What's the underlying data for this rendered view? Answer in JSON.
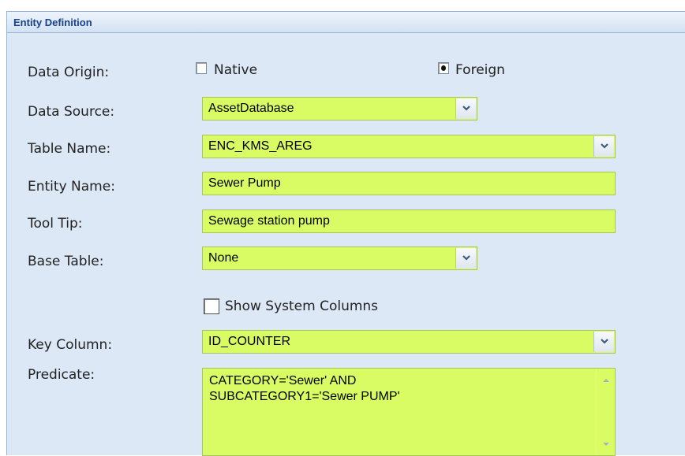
{
  "panel": {
    "title": "Entity Definition"
  },
  "data_origin": {
    "label": "Data Origin:",
    "options": [
      "Native",
      "Foreign"
    ],
    "selected": "Foreign"
  },
  "data_source": {
    "label": "Data Source:",
    "value": "AssetDatabase"
  },
  "table_name": {
    "label": "Table Name:",
    "value": "ENC_KMS_AREG"
  },
  "entity_name": {
    "label": "Entity Name:",
    "value": "Sewer Pump"
  },
  "tool_tip": {
    "label": "Tool Tip:",
    "value": "Sewage station pump"
  },
  "base_table": {
    "label": "Base Table:",
    "value": "None"
  },
  "show_system_columns": {
    "label": "Show System Columns",
    "checked": false
  },
  "key_column": {
    "label": "Key Column:",
    "value": "ID_COUNTER"
  },
  "predicate": {
    "label": "Predicate:",
    "value": "CATEGORY='Sewer' AND\nSUBCATEGORY1='Sewer PUMP'"
  },
  "colors": {
    "field_bg": "#d9fb63",
    "panel_bg": "#dde8f6",
    "header_text": "#15428b"
  }
}
